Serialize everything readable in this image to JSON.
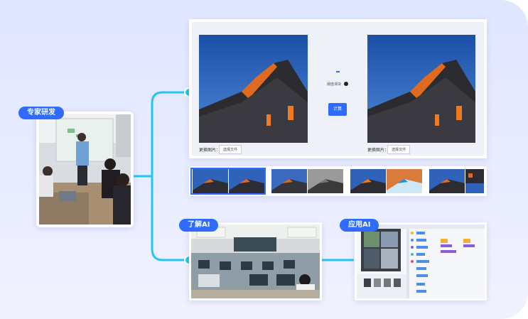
{
  "tags": {
    "expert": "专家研发",
    "learn": "了解AI",
    "apply": "应用AI"
  },
  "panel": {
    "left_label": "更换图片：",
    "left_button": "选择文件",
    "mid_text": "阈值滑块",
    "calc_button": "计算",
    "right_label": "更换图片：",
    "right_button": "选择文件"
  },
  "colors": {
    "accent": "#2f6bff",
    "connector": "#22c6f0"
  }
}
